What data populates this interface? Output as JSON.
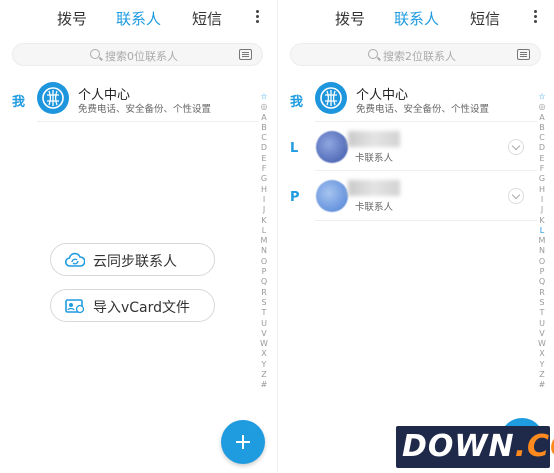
{
  "left": {
    "tabs": [
      {
        "label": "拨号"
      },
      {
        "label": "联系人"
      },
      {
        "label": "短信"
      }
    ],
    "search_placeholder": "搜索0位联系人",
    "section_me": "我",
    "me": {
      "name": "个人中心",
      "subtitle": "免费电话、安全备份、个性设置"
    },
    "index": [
      "☆",
      "◎",
      "A",
      "B",
      "C",
      "D",
      "E",
      "F",
      "G",
      "H",
      "I",
      "J",
      "K",
      "L",
      "M",
      "N",
      "O",
      "P",
      "Q",
      "R",
      "S",
      "T",
      "U",
      "V",
      "W",
      "X",
      "Y",
      "Z",
      "#"
    ],
    "cloud_sync_label": "云同步联系人",
    "import_vcard_label": "导入vCard文件"
  },
  "right": {
    "tabs": [
      {
        "label": "拨号"
      },
      {
        "label": "联系人"
      },
      {
        "label": "短信"
      }
    ],
    "search_placeholder": "搜索2位联系人",
    "section_me": "我",
    "me": {
      "name": "个人中心",
      "subtitle": "免费电话、安全备份、个性设置"
    },
    "contacts": [
      {
        "section": "L",
        "subtitle": "卡联系人"
      },
      {
        "section": "P",
        "subtitle": "卡联系人"
      }
    ],
    "index": [
      "☆",
      "◎",
      "A",
      "B",
      "C",
      "D",
      "E",
      "F",
      "G",
      "H",
      "I",
      "J",
      "K",
      "L",
      "M",
      "N",
      "O",
      "P",
      "Q",
      "R",
      "S",
      "T",
      "U",
      "V",
      "W",
      "X",
      "Y",
      "Z",
      "#"
    ],
    "index_highlight": "L"
  },
  "watermark": {
    "main": "DOWN",
    "suffix": ".CC"
  },
  "colors": {
    "accent": "#1f9be0",
    "avatar": "#1e96dd"
  }
}
